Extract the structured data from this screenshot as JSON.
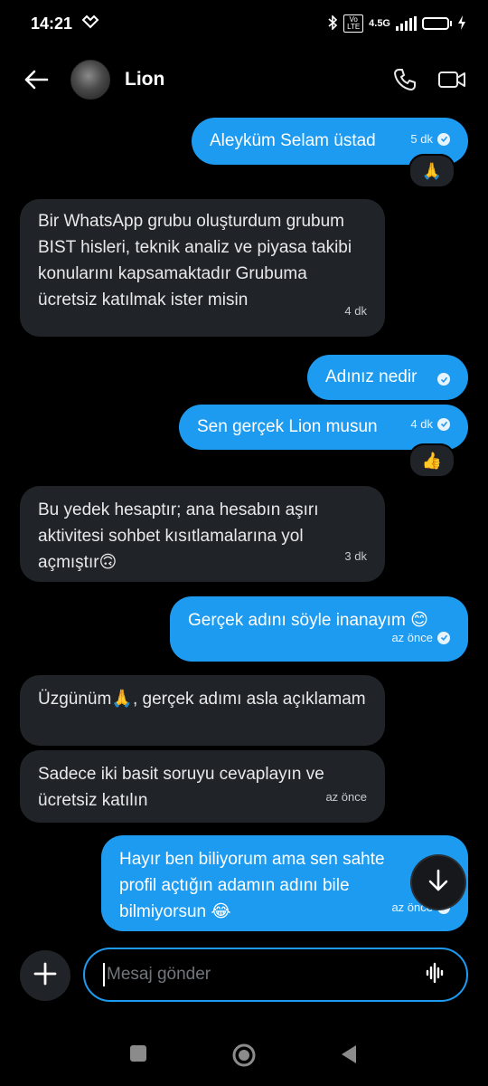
{
  "status_bar": {
    "time": "14:21",
    "network": "4.5G",
    "volte": "Vo LTE",
    "battery": "60",
    "battery_level_pct": 60
  },
  "header": {
    "contact_name": "Lion"
  },
  "messages": [
    {
      "text": "Aleyküm Selam üstad",
      "time": "5 dk",
      "reaction": "🙏"
    },
    {
      "text": "Bir WhatsApp grubu oluşturdum grubum BIST hisleri, teknik analiz ve piyasa takibi konularını kapsamaktadır Grubuma ücretsiz katılmak  ister misin",
      "time": "4 dk"
    },
    {
      "text": "Adınız nedir"
    },
    {
      "text": "Sen gerçek Lion musun",
      "time": "4 dk",
      "reaction": "👍"
    },
    {
      "text": "Bu yedek hesaptır; ana hesabın aşırı aktivitesi sohbet kısıtlamalarına yol açmıştır🙃",
      "time": "3 dk"
    },
    {
      "text": "Gerçek adını söyle inanayım 😊",
      "time": "az önce"
    },
    {
      "text": "Üzgünüm🙏, gerçek adımı asla açıklamam"
    },
    {
      "text": "Sadece iki basit soruyu cevaplayın ve ücretsiz katılın",
      "time": "az önce"
    },
    {
      "text": "Hayır ben biliyorum ama sen sahte profil açtığın adamın adını bile bilmiyorsun 😂",
      "time": "az önce"
    }
  ],
  "composer": {
    "placeholder": "Mesaj gönder"
  },
  "colors": {
    "accent": "#1d9bf0",
    "incoming_bubble": "#202327",
    "background": "#000000"
  },
  "icons": [
    "back-arrow-icon",
    "phone-icon",
    "video-icon",
    "check-icon",
    "arrow-down-icon",
    "plus-icon",
    "voice-wave-icon",
    "bluetooth-icon",
    "wifi-icon"
  ]
}
